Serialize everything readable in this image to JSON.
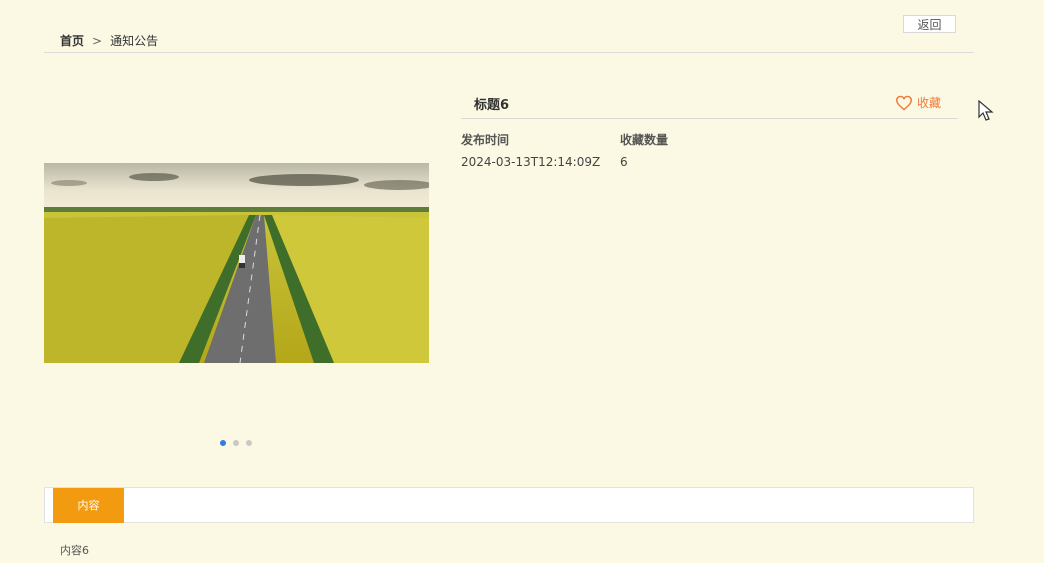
{
  "breadcrumb": {
    "home": "首页",
    "separator": ">",
    "current": "通知公告"
  },
  "back_button": "返回",
  "detail": {
    "title": "标题6",
    "favorite_label": "收藏",
    "publish_time_label": "发布时间",
    "publish_time": "2024-03-13T12:14:09Z",
    "favorites_count_label": "收藏数量",
    "favorites_count": "6"
  },
  "carousel": {
    "image_icon": "landscape-photo",
    "slides": 3,
    "active_index": 0
  },
  "tabs": [
    {
      "label": "内容",
      "active": true
    }
  ],
  "content": {
    "text": "内容6"
  },
  "colors": {
    "accent": "#f29a10",
    "favorite": "#f07a3a",
    "dot_active": "#2f7de1",
    "background": "#fbf9e3"
  }
}
